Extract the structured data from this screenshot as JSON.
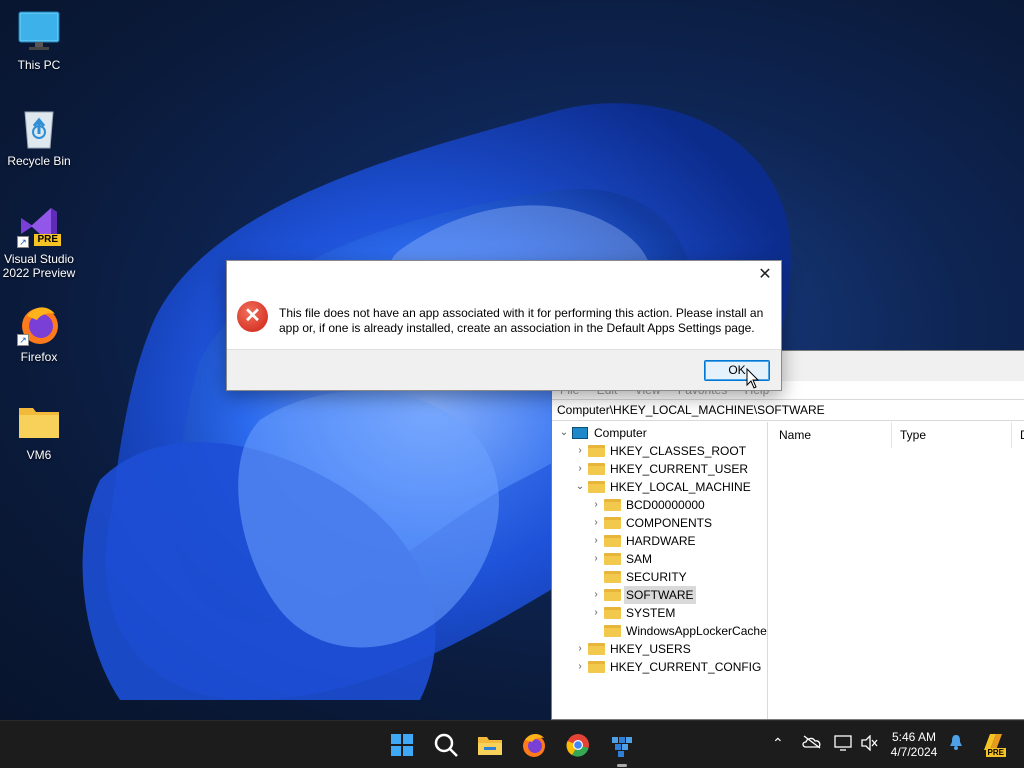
{
  "desktop": {
    "icons": [
      {
        "label": "This PC",
        "icon": "monitor-icon"
      },
      {
        "label": "Recycle Bin",
        "icon": "recycle-bin-icon"
      },
      {
        "label": "Visual Studio 2022 Preview",
        "icon": "visual-studio-icon",
        "badge": "PRE"
      },
      {
        "label": "Firefox",
        "icon": "firefox-icon"
      },
      {
        "label": "VM6",
        "icon": "folder-icon"
      }
    ]
  },
  "dialog": {
    "message": "This file does not have an app associated with it for performing this action. Please install an app or, if one is already installed, create an association in the Default Apps Settings page.",
    "ok_label": "OK",
    "close_glyph": "✕",
    "icon": "error-icon",
    "accent": "#0078d4",
    "error_color": "#d8382a"
  },
  "regedit": {
    "menu": [
      "File",
      "Edit",
      "View",
      "Favorites",
      "Help"
    ],
    "address": "Computer\\HKEY_LOCAL_MACHINE\\SOFTWARE",
    "tree": {
      "root": "Computer",
      "hives": [
        "HKEY_CLASSES_ROOT",
        "HKEY_CURRENT_USER",
        "HKEY_LOCAL_MACHINE"
      ],
      "hklm_children": [
        "BCD00000000",
        "COMPONENTS",
        "HARDWARE",
        "SAM",
        "SECURITY",
        "SOFTWARE",
        "SYSTEM",
        "WindowsAppLockerCache"
      ],
      "after": [
        "HKEY_USERS",
        "HKEY_CURRENT_CONFIG"
      ],
      "selected": "SOFTWARE"
    },
    "columns": [
      "Name",
      "Type",
      "D"
    ]
  },
  "taskbar": {
    "apps": [
      "start-icon",
      "search-icon",
      "file-explorer-icon",
      "firefox-icon",
      "chrome-icon",
      "registry-editor-icon"
    ],
    "tray": [
      "chevron-up-icon",
      "onedrive-icon",
      "network-icon",
      "volume-muted-icon"
    ],
    "time": "5:46 AM",
    "date": "4/7/2024",
    "copilot_badge": "PRE"
  }
}
